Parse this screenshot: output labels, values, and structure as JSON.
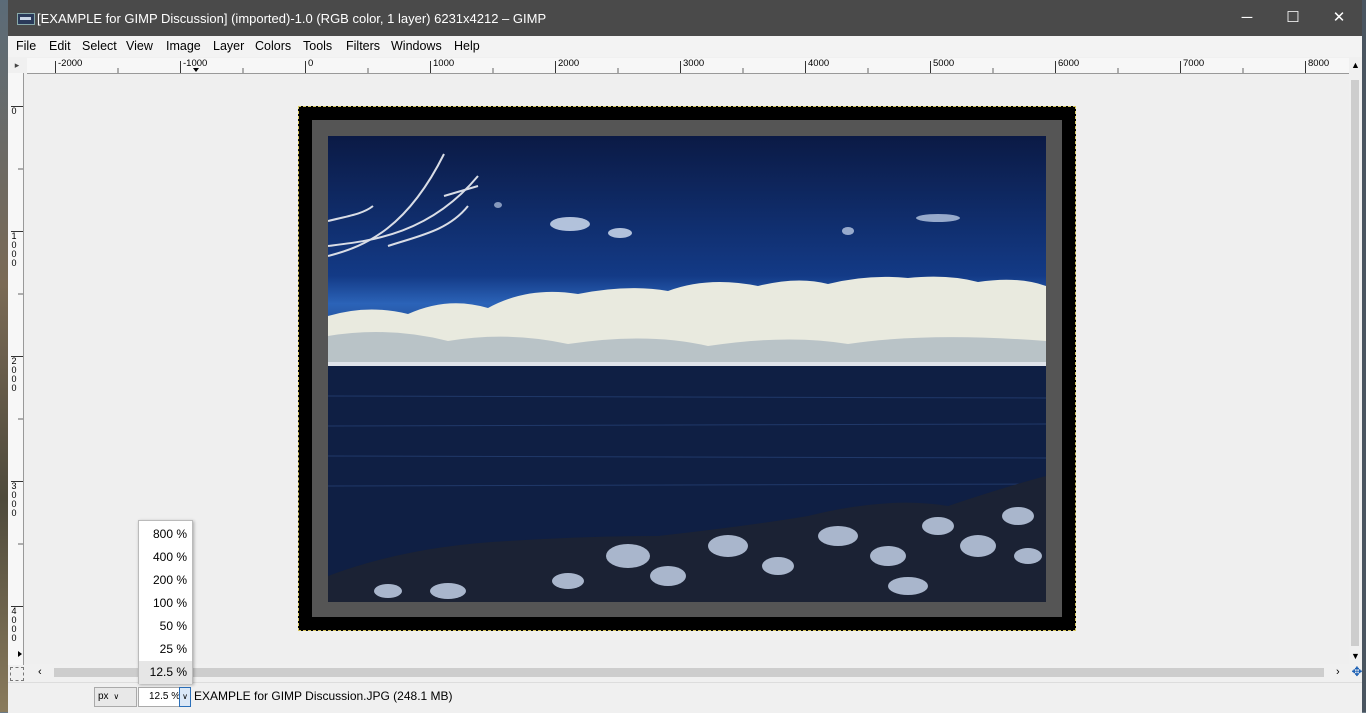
{
  "window": {
    "title": "[EXAMPLE for GIMP Discussion] (imported)-1.0 (RGB color, 1 layer) 6231x4212 – GIMP",
    "controls": {
      "minimize": "─",
      "maximize": "☐",
      "close": "✕"
    }
  },
  "menubar": {
    "items": [
      {
        "label": "File"
      },
      {
        "label": "Edit"
      },
      {
        "label": "Select"
      },
      {
        "label": "View"
      },
      {
        "label": "Image"
      },
      {
        "label": "Layer"
      },
      {
        "label": "Colors"
      },
      {
        "label": "Tools"
      },
      {
        "label": "Filters"
      },
      {
        "label": "Windows"
      },
      {
        "label": "Help"
      }
    ]
  },
  "rulers": {
    "horizontal": [
      "-2000",
      "-1000",
      "0",
      "1000",
      "2000",
      "3000",
      "4000",
      "5000",
      "6000",
      "7000",
      "8000"
    ],
    "vertical": [
      "0",
      "1000",
      "2000",
      "3000",
      "4000"
    ]
  },
  "zoom_menu": {
    "options": [
      "800 %",
      "400 %",
      "200 %",
      "100 %",
      "50 %",
      "25 %",
      "12.5 %"
    ],
    "selected": "12.5 %"
  },
  "statusbar": {
    "unit": "px",
    "zoom": "12.5 %",
    "file_info": "EXAMPLE for GIMP Discussion.JPG (248.1 MB)"
  },
  "icons": {
    "ruler_corner": "triangle-right-icon",
    "navigate": "move-arrows-icon",
    "quickmask": "quickmask-icon"
  },
  "colors": {
    "titlebar": "#4a4a4a",
    "canvas": "#efefef",
    "selection_border": "#d8c860"
  }
}
